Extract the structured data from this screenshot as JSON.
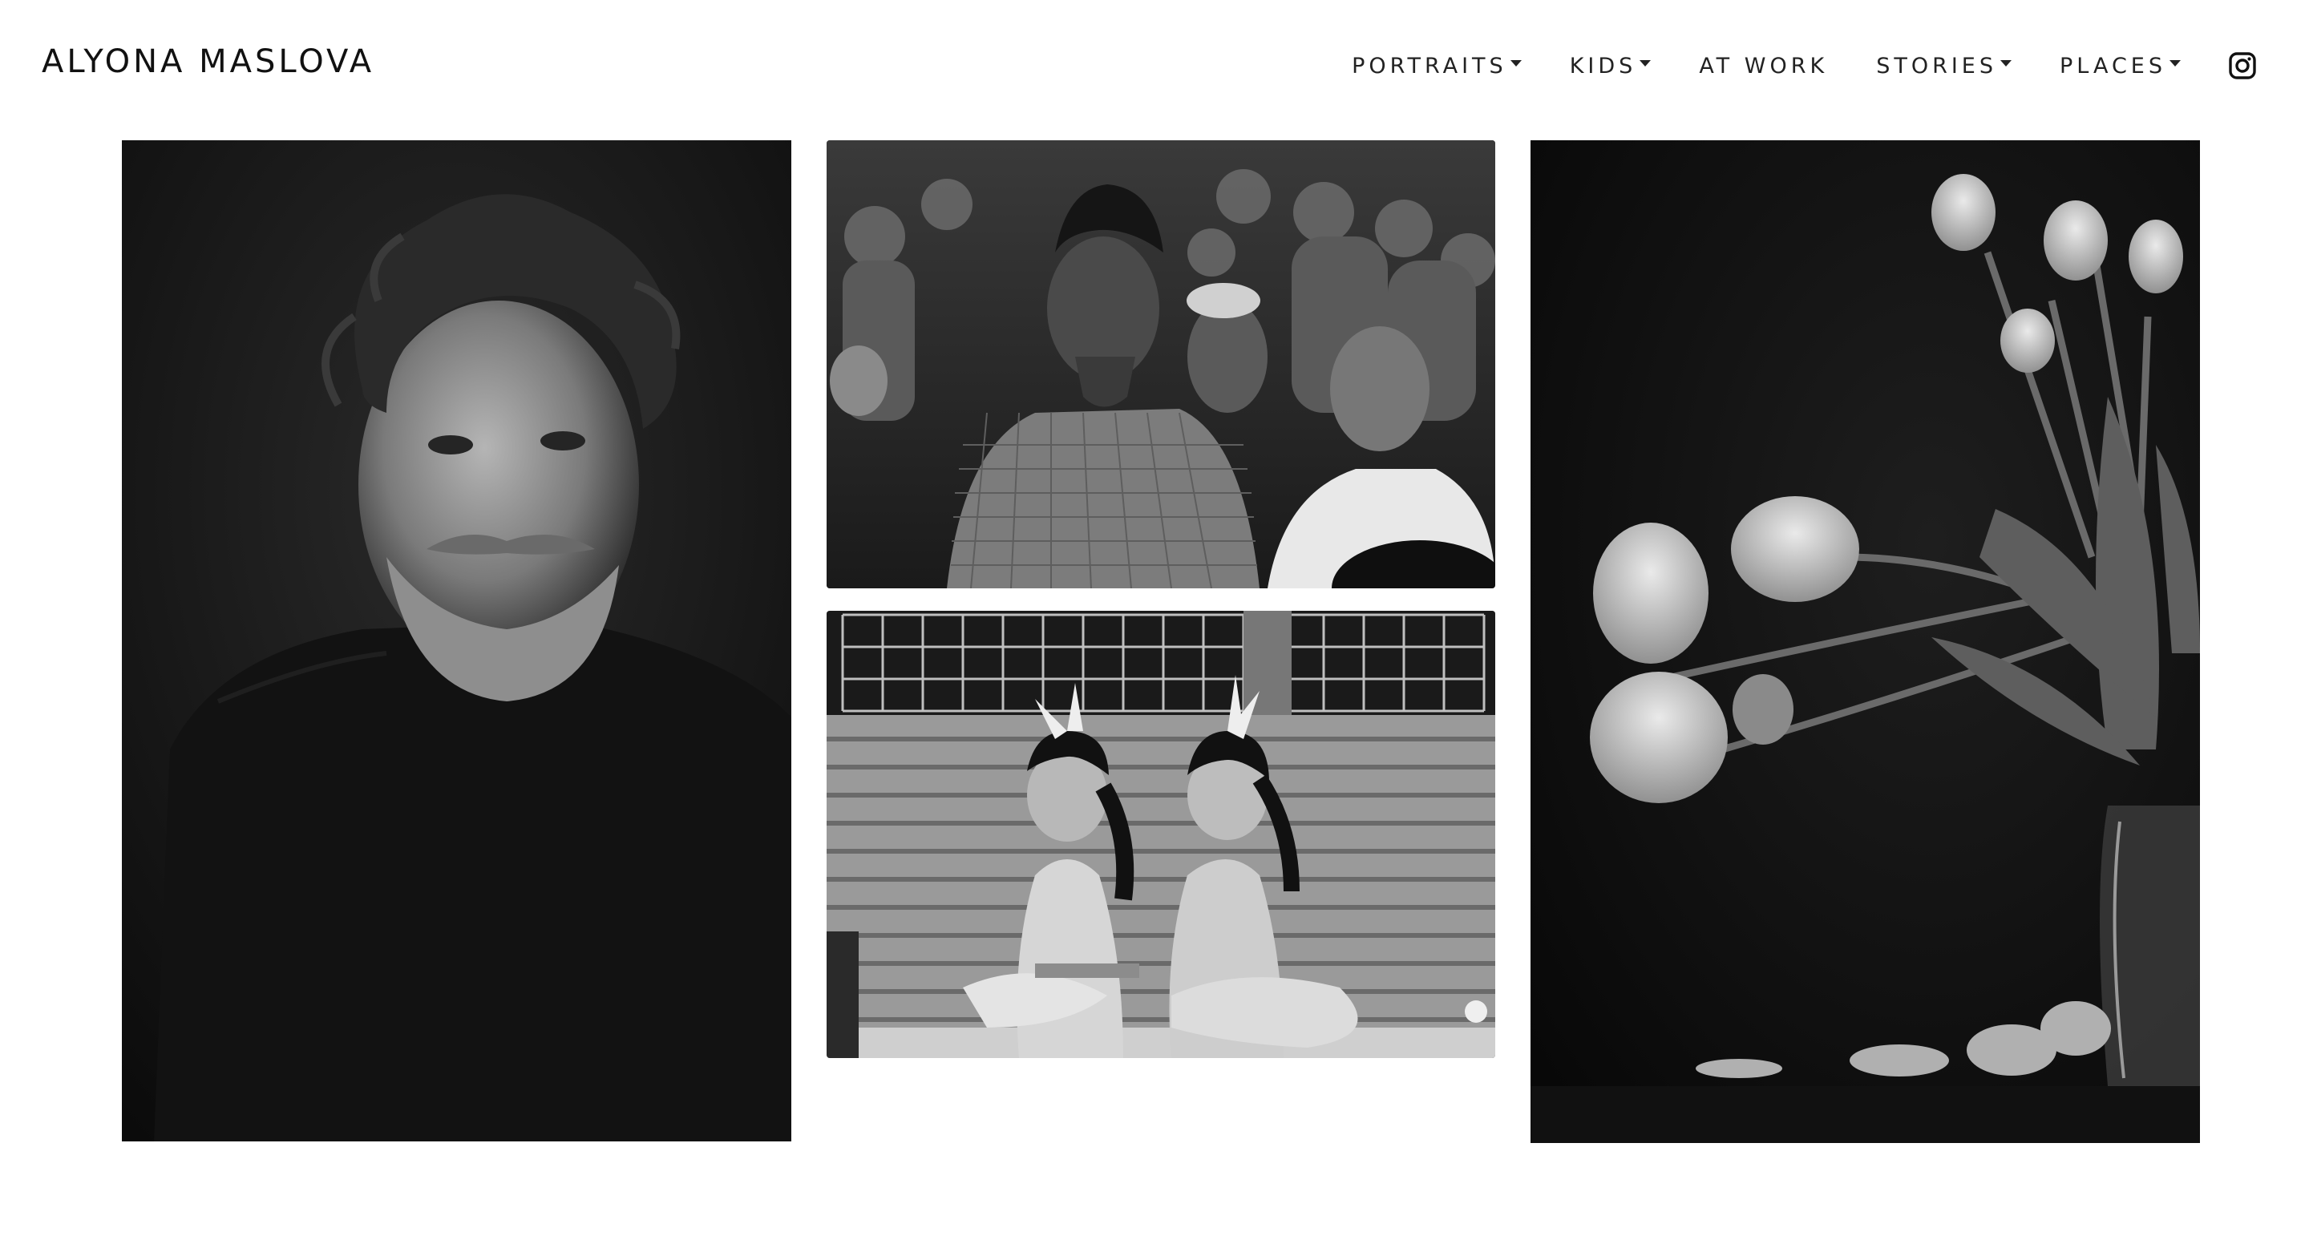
{
  "site": {
    "title": "ALYONA MASLOVA"
  },
  "nav": {
    "items": [
      {
        "label": "PORTRAITS",
        "dropdown": true
      },
      {
        "label": "KIDS",
        "dropdown": true
      },
      {
        "label": "AT WORK",
        "dropdown": false
      },
      {
        "label": "STORIES",
        "dropdown": true
      },
      {
        "label": "PLACES",
        "dropdown": true
      }
    ],
    "social_icon": "instagram-icon"
  },
  "gallery": {
    "photos": [
      {
        "subject": "portrait-man-black-and-white"
      },
      {
        "subject": "crowd-street-black-and-white"
      },
      {
        "subject": "two-girls-on-steps-black-and-white"
      },
      {
        "subject": "tulips-still-life-black-and-white"
      }
    ]
  },
  "colors": {
    "background": "#ffffff",
    "text": "#111111",
    "photo_dark": "#0a0a0a"
  }
}
